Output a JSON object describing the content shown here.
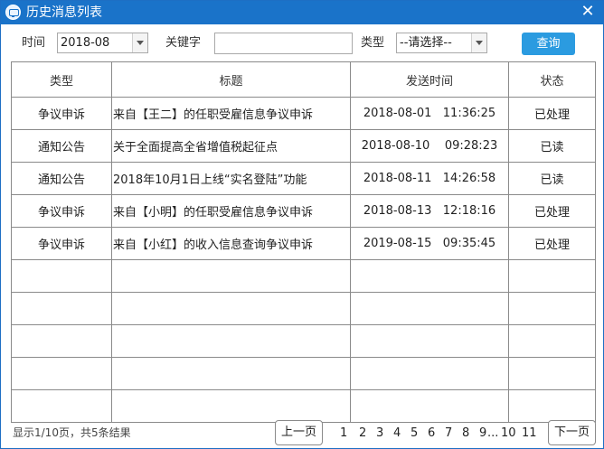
{
  "window": {
    "title": "历史消息列表"
  },
  "filters": {
    "time_label": "时间",
    "time_value": "2018-08",
    "keyword_label": "关键字",
    "keyword_value": "",
    "type_label": "类型",
    "type_value": "--请选择--",
    "query_label": "查询"
  },
  "table": {
    "headers": [
      "类型",
      "标题",
      "发送时间",
      "状态"
    ],
    "rows": [
      {
        "type": "争议申诉",
        "title": "来自【王二】的任职受雇信息争议申诉",
        "time": "2018-08-01   11:36:25",
        "status": "已处理"
      },
      {
        "type": "通知公告",
        "title": "关于全面提高全省增值税起征点",
        "time": "2018-08-10    09:28:23",
        "status": "已读"
      },
      {
        "type": "通知公告",
        "title": "2018年10月1日上线“实名登陆”功能",
        "time": "2018-08-11   14:26:58",
        "status": "已读"
      },
      {
        "type": "争议申诉",
        "title": "来自【小明】的任职受雇信息争议申诉",
        "time": "2018-08-13   12:18:16",
        "status": "已处理"
      },
      {
        "type": "争议申诉",
        "title": "来自【小红】的收入信息查询争议申诉",
        "time": "2019-08-15   09:35:45",
        "status": "已处理"
      }
    ],
    "empty_rows": 5
  },
  "pagination": {
    "info": "显示1/10页，共5条结果",
    "prev_label": "上一页",
    "next_label": "下一页",
    "pages_before": [
      "1",
      "2",
      "3",
      "4",
      "5",
      "6",
      "7",
      "8",
      "9"
    ],
    "ellipsis": "...",
    "pages_after": [
      "10",
      "11"
    ]
  },
  "colors": {
    "titlebar": "#1a73c9",
    "query_button": "#2b9be0",
    "grid_border": "#8a8a8a"
  }
}
